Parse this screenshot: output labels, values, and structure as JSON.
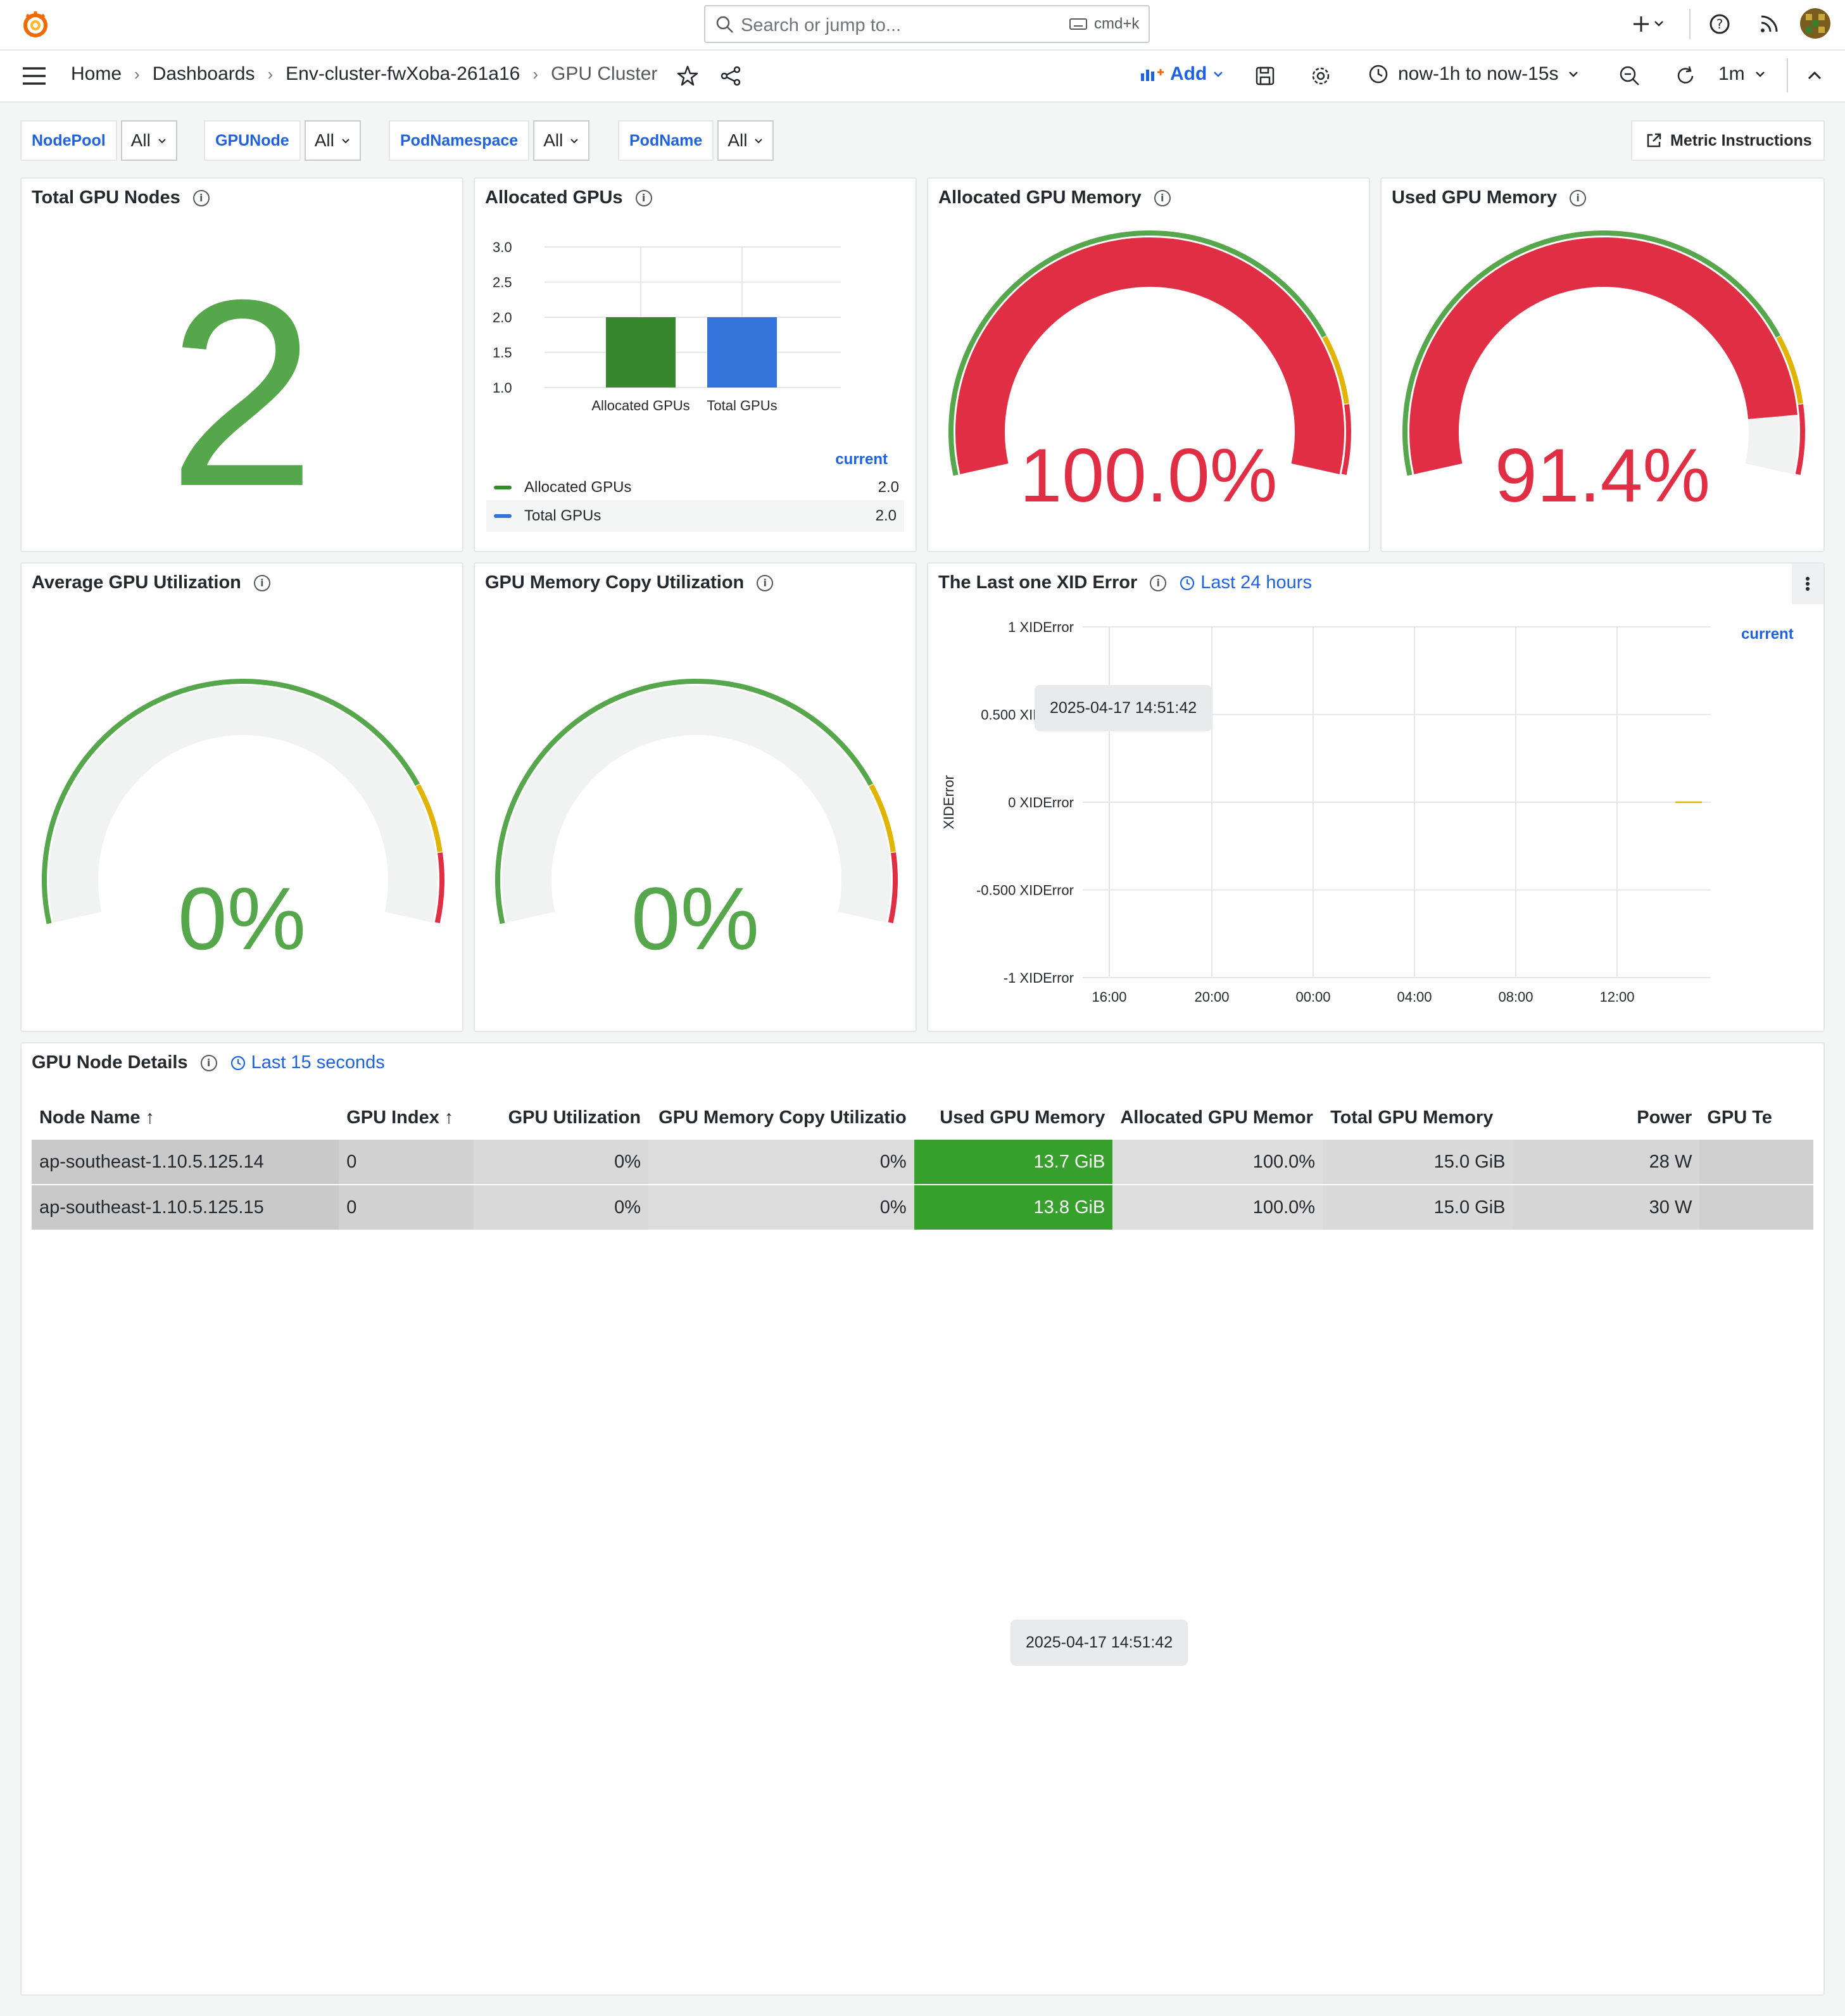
{
  "topbar": {
    "search_placeholder": "Search or jump to...",
    "shortcut": "cmd+k"
  },
  "breadcrumbs": {
    "home": "Home",
    "dashboards": "Dashboards",
    "folder": "Env-cluster-fwXoba-261a16",
    "current": "GPU Cluster"
  },
  "toolbar": {
    "add_label": "Add",
    "time_range": "now-1h to now-15s",
    "refresh_interval": "1m"
  },
  "variables": [
    {
      "label": "NodePool",
      "value": "All"
    },
    {
      "label": "GPUNode",
      "value": "All"
    },
    {
      "label": "PodNamespace",
      "value": "All"
    },
    {
      "label": "PodName",
      "value": "All"
    }
  ],
  "metric_instructions": "Metric Instructions",
  "panels": {
    "total_nodes": {
      "title": "Total GPU Nodes",
      "value": "2",
      "color": "#56a64b"
    },
    "allocated_gpus": {
      "title": "Allocated GPUs",
      "legend_header": "current"
    },
    "allocated_mem": {
      "title": "Allocated GPU Memory",
      "value": "100.0%",
      "fraction": 1.0,
      "color": "#e02f44"
    },
    "used_mem": {
      "title": "Used GPU Memory",
      "value": "91.4%",
      "fraction": 0.914,
      "color": "#e02f44"
    },
    "avg_util": {
      "title": "Average GPU Utilization",
      "value": "0%",
      "fraction": 0,
      "color": "#56a64b"
    },
    "mem_copy": {
      "title": "GPU Memory Copy Utilization",
      "value": "0%",
      "fraction": 0,
      "color": "#56a64b"
    },
    "xid": {
      "title": "The Last one XID Error",
      "time_tag": "Last 24 hours",
      "legend_header": "current",
      "ylabel": "XIDError",
      "tooltip": "2025-04-17 14:51:42"
    },
    "details": {
      "title": "GPU Node Details",
      "time_tag": "Last 15 seconds"
    }
  },
  "chart_data": [
    {
      "type": "bar",
      "categories": [
        "Allocated GPUs",
        "Total GPUs"
      ],
      "values": [
        2.0,
        2.0
      ],
      "series": [
        {
          "name": "Allocated GPUs",
          "values": [
            2.0
          ],
          "color": "#37872d"
        },
        {
          "name": "Total GPUs",
          "values": [
            2.0
          ],
          "color": "#3274d9"
        }
      ],
      "yticks": [
        "3.0",
        "2.5",
        "2.0",
        "1.5",
        "1.0"
      ],
      "ylim": [
        1.0,
        3.0
      ],
      "legend": [
        {
          "name": "Allocated GPUs",
          "current": "2.0",
          "color": "#37872d"
        },
        {
          "name": "Total GPUs",
          "current": "2.0",
          "color": "#3274d9"
        }
      ]
    },
    {
      "type": "line",
      "ylabel": "XIDError",
      "yticks": [
        "1 XIDError",
        "0.500 XIDError",
        "0 XIDError",
        "-0.500 XIDError",
        "-1 XIDError"
      ],
      "xticks": [
        "16:00",
        "20:00",
        "00:00",
        "04:00",
        "08:00",
        "12:00"
      ],
      "ylim": [
        -1,
        1
      ],
      "series": [
        {
          "values": [
            0,
            0
          ],
          "color": "#e0b400"
        }
      ]
    }
  ],
  "table": {
    "columns": [
      "Node Name",
      "GPU Index",
      "GPU Utilization",
      "GPU Memory Copy Utilizatio",
      "Used GPU Memory",
      "Allocated GPU Memor",
      "Total GPU Memory",
      "Power",
      "GPU Te"
    ],
    "rows": [
      {
        "node": "ap-southeast-1.10.5.125.14",
        "index": "0",
        "util": "0%",
        "copy": "0%",
        "used": "13.7 GiB",
        "alloc": "100.0%",
        "total": "15.0 GiB",
        "power": "28 W",
        "temp": ""
      },
      {
        "node": "ap-southeast-1.10.5.125.15",
        "index": "0",
        "util": "0%",
        "copy": "0%",
        "used": "13.8 GiB",
        "alloc": "100.0%",
        "total": "15.0 GiB",
        "power": "30 W",
        "temp": ""
      }
    ]
  },
  "bottom_tooltip": "2025-04-17 14:51:42"
}
